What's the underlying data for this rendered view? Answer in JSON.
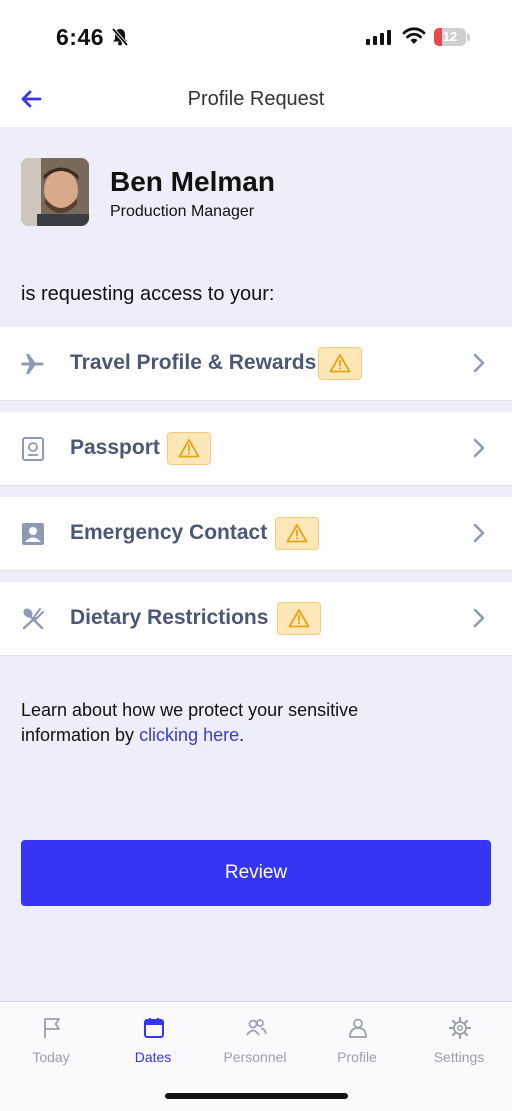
{
  "status_bar": {
    "time": "6:46",
    "battery": "12"
  },
  "header": {
    "title": "Profile Request"
  },
  "requester": {
    "name": "Ben Melman",
    "role": "Production Manager"
  },
  "request_text": "is requesting access to your:",
  "items": [
    {
      "label": "Travel Profile & Rewards",
      "icon": "airplane-icon"
    },
    {
      "label": "Passport",
      "icon": "passport-icon"
    },
    {
      "label": "Emergency Contact",
      "icon": "contact-card-icon"
    },
    {
      "label": "Dietary Restrictions",
      "icon": "utensils-icon"
    }
  ],
  "learn": {
    "text": "Learn about how we protect your sensitive information by ",
    "link": "clicking here",
    "end": "."
  },
  "review_button": "Review",
  "tabs": [
    {
      "label": "Today",
      "icon": "flag-icon",
      "active": false
    },
    {
      "label": "Dates",
      "icon": "calendar-icon",
      "active": true
    },
    {
      "label": "Personnel",
      "icon": "people-icon",
      "active": false
    },
    {
      "label": "Profile",
      "icon": "person-icon",
      "active": false
    },
    {
      "label": "Settings",
      "icon": "gear-icon",
      "active": false
    }
  ],
  "colors": {
    "accent": "#3535f3",
    "background": "#eeeefa",
    "warning": "#fde7b8",
    "label": "#4a5874"
  }
}
